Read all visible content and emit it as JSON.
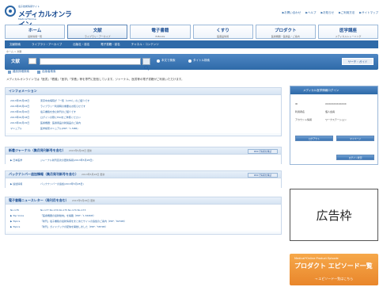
{
  "header": {
    "logo_sup": "電子技術情報サイト",
    "logo_name": "メディカルオンライン",
    "logo_sub": "Medical*Online",
    "utility_links": [
      "▶お問い合わせ",
      "▶ヘルプ",
      "▶お知らせ",
      "▶ご利用方法",
      "▶サイトマップ"
    ]
  },
  "nav": {
    "tabs": [
      {
        "label": "ホーム",
        "sub": "最新情報一覧"
      },
      {
        "label": "文献",
        "sub": "ライブラリ・アーカイブ"
      },
      {
        "label": "電子書籍",
        "sub": "E-Books"
      },
      {
        "label": "くすり",
        "sub": "医薬品情報"
      },
      {
        "label": "プロダクト",
        "sub": "医療機器・医療品・ご案内"
      },
      {
        "label": "医学講座",
        "sub": "メディカルトレーニング"
      }
    ],
    "active_index": 1,
    "subnav": [
      "文献検索",
      "ライブラリ・アーカイブ",
      "出版社・誌名",
      "電子書籍・誌名",
      "チャネル・コンテンツ"
    ]
  },
  "breadcrumb": "ホーム > 文献",
  "search": {
    "label": "文献",
    "options": [
      "本文で検索",
      "タイトル検索"
    ],
    "guide_button": "サーチ・ガイド",
    "tabs": [
      "雑誌詳細検索",
      "出版者検索"
    ]
  },
  "intro": "メディカルオンラインでは「医書」「看護」「医学」「栄養」等を専門に配信しています。ジャーナル、医書等の電子書籍がご利用いただけます。",
  "sections": [
    {
      "title": "インフォメーション",
      "rows": [
        {
          "date": "2013年05月28日",
          "text": "東京中央病院が「一覧（1/55）」のご紹介です"
        },
        {
          "date": "2013年05月22日",
          "text": "ライブラリー利用時の重要なお知らせです"
        },
        {
          "date": "2013年04月20日",
          "text": "電子書籍を含む新刊のご紹介です"
        },
        {
          "date": "2013年04月18日",
          "text": "ログインの際にFAQをご参照ください"
        },
        {
          "date": "2013年04月15日",
          "text": "医療機器：医療用品の新製品のご案内"
        },
        {
          "date": "マニュアル",
          "text": "医学検索マニュアル(PDF／1.5MB)"
        }
      ]
    },
    {
      "title": "新着ジャーナル（集月発刊新号を含む）",
      "date": "2013年5月28日 更新",
      "rss": "RSSで情報を購読",
      "rows": [
        {
          "date": "▶ 日本医学",
          "text": "ジャーナル新刊目次の更新情報(2013年5月28日)"
        }
      ]
    },
    {
      "title": "バックナンバー追加情報（集月発刊新号を含む）",
      "date": "2013年5月28日 更新",
      "rss": "RSSで情報を購読",
      "rows": [
        {
          "date": "▶ 追加情報",
          "text": "バックナンバーの追加(2013年5月28日)"
        }
      ]
    },
    {
      "title": "電子書籍ニュースレター（発刊月を含む）",
      "date": "2013年5月28日 更新",
      "rows": [
        {
          "date": "No.178",
          "text": "No.177 No.176 No.175 No.174 No.173"
        },
        {
          "date": "▶ Top Voice",
          "text": "「医療機器の最新動向」を掲載（PDF／1,563KB）"
        },
        {
          "date": "▶ Topics",
          "text": "「新刊」電子書籍の最新情報をまとめたサイトの追加のご案内（PDF／823KB）"
        },
        {
          "date": "▶ Topics",
          "text": "「新刊」ガイドブックの配信を開始しました（PDF／587KB）"
        }
      ]
    }
  ],
  "login": {
    "title": "メディカル医学情報ログイン",
    "fields": [
      {
        "k": "ID",
        "v": "XXXXXXXXXXXXX"
      },
      {
        "k": "利用者名",
        "v": "個人会員"
      },
      {
        "k": "アカウント情報",
        "v": "ワークステーション"
      }
    ],
    "buttons": [
      "ログアウト",
      "マイページ",
      "ログイン状況"
    ]
  },
  "ad": {
    "label": "広告枠"
  },
  "promo": {
    "line1": "Medical*Online Product Episode",
    "line2": "プロダクト エピソード一覧",
    "line3": "→ エピソード一覧はこちら"
  },
  "colors": {
    "brand": "#1d4f94",
    "accent": "#2f6aa8",
    "promo": "#e9862b"
  }
}
